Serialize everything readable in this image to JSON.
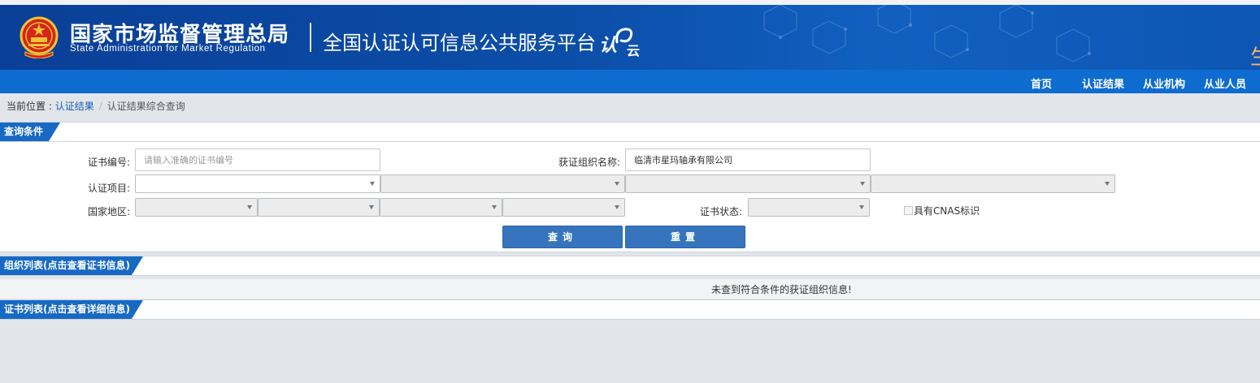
{
  "header": {
    "org_name_cn": "国家市场监督管理总局",
    "org_name_en": "State Administration  for  Market Regulation",
    "platform_title": "全国认证认可信息公共服务平台",
    "logo_text_a": "认",
    "logo_text_b": "云",
    "edge_glyph": "生"
  },
  "nav": {
    "items": [
      {
        "label": "首页"
      },
      {
        "label": "认证结果"
      },
      {
        "label": "从业机构"
      },
      {
        "label": "从业人员"
      }
    ]
  },
  "breadcrumb": {
    "prefix": "当前位置 : ",
    "link": "认证结果",
    "separator": "/",
    "current": "认证结果综合查询"
  },
  "query": {
    "section_title": "查询条件",
    "cert_no_label": "证书编号:",
    "cert_no_placeholder": "请输入准确的证书编号",
    "cert_no_value": "",
    "org_name_label": "获证组织名称:",
    "org_name_value": "临清市星玛轴承有限公司",
    "project_label": "认证项目:",
    "region_label": "国家地区:",
    "status_label": "证书状态:",
    "cnas_label": "具有CNAS标识",
    "search_button": "查询",
    "reset_button": "重置"
  },
  "org_list": {
    "section_title": "组织列表(点击查看证书信息)",
    "empty_message": "未查到符合条件的获证组织信息!"
  },
  "cert_list": {
    "section_title": "证书列表(点击查看详细信息)"
  },
  "colors": {
    "header_bg": "#0b4ea8",
    "nav_bg": "#0e6cd0",
    "section_tab": "#1769c4",
    "button": "#3675bd",
    "page_bg": "#e2e6ea"
  }
}
